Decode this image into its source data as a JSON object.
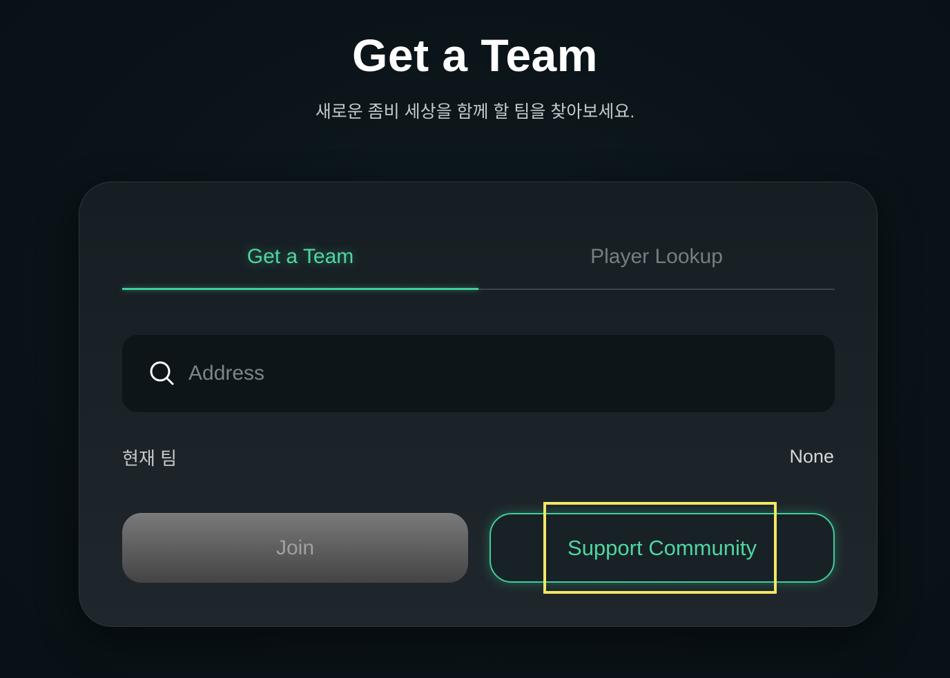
{
  "header": {
    "title": "Get a Team",
    "subtitle": "새로운 좀비 세상을 함께 할 팀을 찾아보세요."
  },
  "tabs": [
    {
      "label": "Get a Team",
      "active": true
    },
    {
      "label": "Player Lookup",
      "active": false
    }
  ],
  "search": {
    "placeholder": "Address",
    "value": "",
    "icon": "search-icon"
  },
  "current_team": {
    "label": "현재 팀",
    "value": "None"
  },
  "buttons": {
    "join_label": "Join",
    "support_label": "Support Community"
  },
  "colors": {
    "accent": "#3fcf99",
    "background": "#0a1419",
    "card": "#1b2328",
    "highlight": "#f5e663"
  }
}
